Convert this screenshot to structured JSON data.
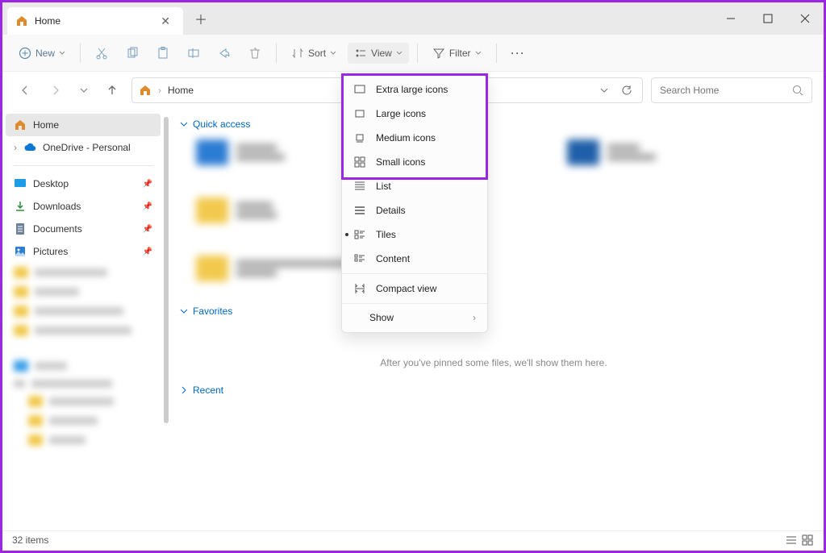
{
  "titlebar": {
    "tab_label": "Home"
  },
  "toolbar": {
    "new": "New",
    "sort": "Sort",
    "view": "View",
    "filter": "Filter"
  },
  "address": {
    "crumb": "Home"
  },
  "search": {
    "placeholder": "Search Home"
  },
  "sidebar": {
    "home": "Home",
    "onedrive": "OneDrive - Personal",
    "desktop": "Desktop",
    "downloads": "Downloads",
    "documents": "Documents",
    "pictures": "Pictures"
  },
  "sections": {
    "quick_access": "Quick access",
    "favorites": "Favorites",
    "recent": "Recent"
  },
  "viewmenu": {
    "extra_large": "Extra large icons",
    "large": "Large icons",
    "medium": "Medium icons",
    "small": "Small icons",
    "list": "List",
    "details": "Details",
    "tiles": "Tiles",
    "content": "Content",
    "compact": "Compact view",
    "show": "Show"
  },
  "empty_msg": "After you've pinned some files, we'll show them here.",
  "status": {
    "count": "32 items"
  }
}
